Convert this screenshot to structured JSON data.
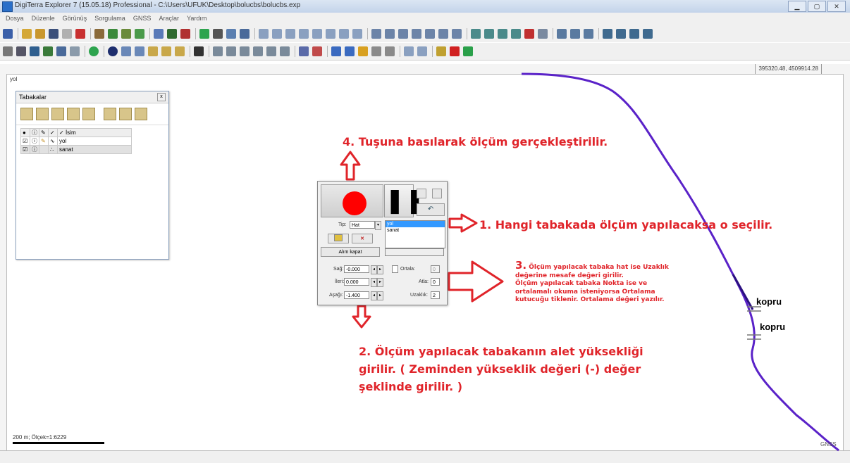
{
  "window": {
    "title": "DigiTerra Explorer 7 (15.05.18) Professional - C:\\Users\\UFUK\\Desktop\\bolucbs\\bolucbs.exp",
    "buttons": [
      "▁",
      "▢",
      "✕"
    ]
  },
  "menubar": [
    "Dosya",
    "Düzenle",
    "Görünüş",
    "Sorgulama",
    "GNSS",
    "Araçlar",
    "Yardım"
  ],
  "ruler": {
    "coords": "395320.48, 4509914.28"
  },
  "canvas": {
    "top_label": "yol",
    "scale_text": "200 m; Ölçek=1:6229",
    "gnss_label": "GNSS"
  },
  "layers_panel": {
    "title": "Tabakalar",
    "header": {
      "name_col": "İsim"
    },
    "rows": [
      {
        "name": "yol"
      },
      {
        "name": "sanat"
      }
    ]
  },
  "gnss_panel": {
    "tip_label": "Tip:",
    "tip_value": "Hat",
    "layer_list": [
      "yol",
      "sanat"
    ],
    "alim_kapat": "Alım kapat",
    "sag_label": "Sağ:",
    "sag_value": "-0.000",
    "ileri_label": "İleri:",
    "ileri_value": "0.000",
    "asagi_label": "Aşağı:",
    "asagi_value": "-1.400",
    "ortalama_label": "Ortala:",
    "ortalama_value": "0",
    "atla_label": "Atla:",
    "atla_value": "0",
    "uzaklik_label": "Uzaklık:",
    "uzaklik_value": "2"
  },
  "annotations": {
    "a4": "4. Tuşuna basılarak ölçüm gerçekleştirilir.",
    "a1": "1. Hangi tabakada ölçüm yapılacaksa o seçilir.",
    "a3_num": "3.",
    "a3_lines": [
      "Ölçüm yapılacak tabaka hat ise Uzaklık",
      "değerine mesafe değeri girilir.",
      "Ölçüm yapılacak tabaka Nokta ise ve",
      "ortalamalı okuma isteniyorsa Ortalama",
      "kutucuğu tiklenir. Ortalama değeri yazılır."
    ],
    "a2_lines": [
      "2. Ölçüm yapılacak tabakanın alet yüksekliği",
      "girilir. ( Zeminden yükseklik değeri (-) değer",
      "şeklinde girilir. )"
    ]
  },
  "map_labels": {
    "kopru1": "kopru",
    "kopru2": "kopru"
  },
  "colors": {
    "annotation": "#e0242a",
    "road": "#5a22c8",
    "record": "#ff0000"
  }
}
